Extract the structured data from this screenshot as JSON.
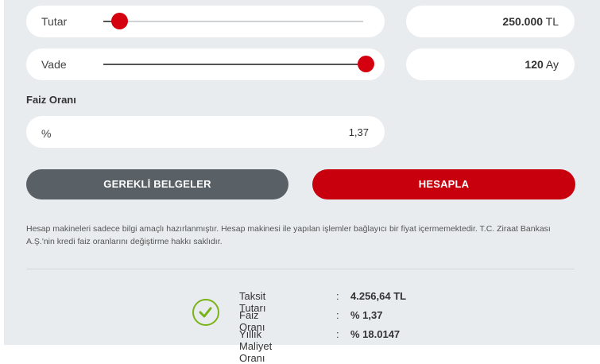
{
  "amount": {
    "label": "Tutar",
    "value": "250.000",
    "unit": "TL",
    "slider_fraction": 0.06
  },
  "term": {
    "label": "Vade",
    "value": "120",
    "unit": "Ay",
    "slider_fraction": 1.0
  },
  "interest": {
    "section_label": "Faiz Oranı",
    "prefix": "%",
    "value": "1,37"
  },
  "buttons": {
    "documents": "GEREKLİ BELGELER",
    "calculate": "HESAPLA"
  },
  "disclaimer": "Hesap makineleri sadece bilgi amaçlı hazırlanmıştır. Hesap makinesi ile yapılan işlemler bağlayıcı bir fiyat içermemektedir. T.C. Ziraat Bankası A.Ş.'nin kredi faiz oranlarını değiştirme hakkı saklıdır.",
  "results": [
    {
      "label": "Taksit Tutarı",
      "sep": ":",
      "value": "4.256,64 TL"
    },
    {
      "label": "Faiz Oranı",
      "sep": ":",
      "value": "% 1,37"
    },
    {
      "label": "Yıllık Maliyet Oranı",
      "sep": ":",
      "value": "% 18.0147"
    }
  ],
  "colors": {
    "accent": "#d4000f",
    "secondary_button": "#5a6166",
    "success": "#7ab317",
    "background": "#e8ecef"
  },
  "icons": {
    "success": "check-circle-icon"
  }
}
